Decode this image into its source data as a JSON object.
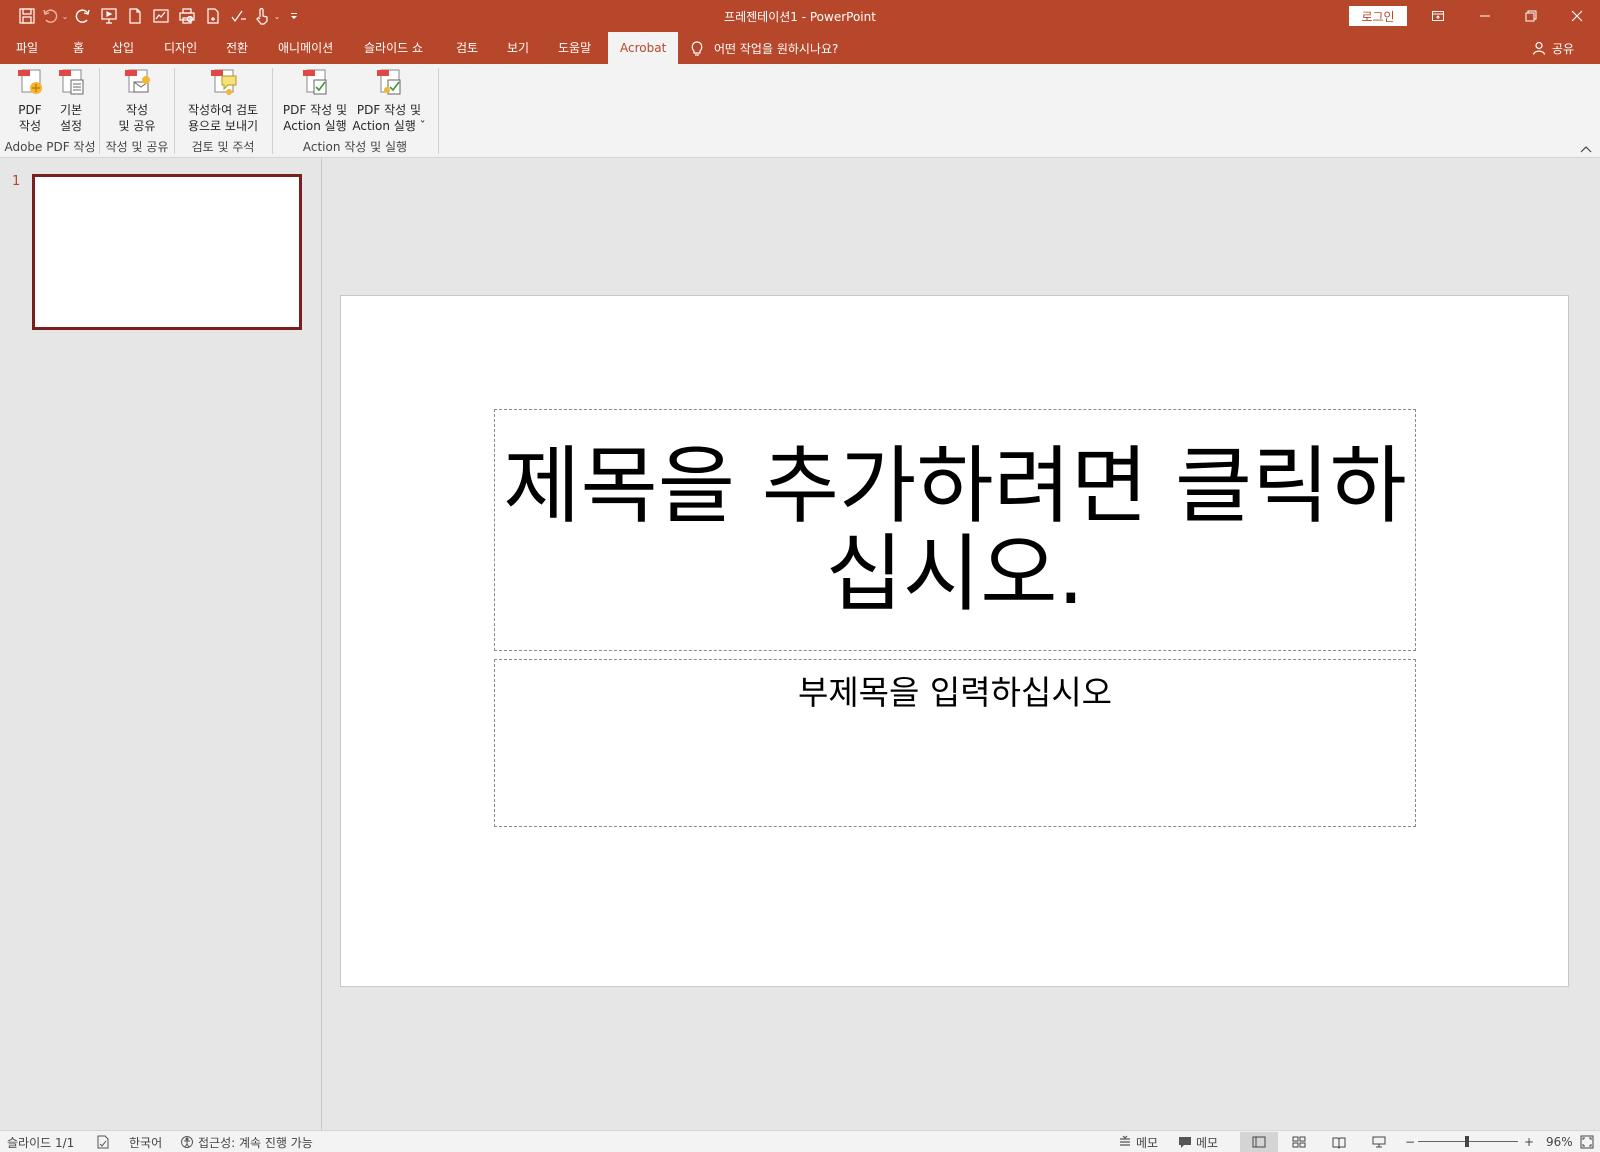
{
  "app": {
    "title": "프레젠테이션1  -  PowerPoint",
    "login_label": "로그인",
    "accent_color": "#b7472a"
  },
  "qat": {
    "icons": [
      "save-icon",
      "undo-icon",
      "redo-icon",
      "start-presentation-icon",
      "new-icon",
      "sign-icon",
      "print-preview-icon",
      "document-icon",
      "spelling-icon",
      "touch-mode-icon",
      "customize-icon"
    ]
  },
  "tabs": [
    {
      "label": "파일"
    },
    {
      "label": "홈"
    },
    {
      "label": "삽입"
    },
    {
      "label": "디자인"
    },
    {
      "label": "전환"
    },
    {
      "label": "애니메이션"
    },
    {
      "label": "슬라이드 쇼"
    },
    {
      "label": "검토"
    },
    {
      "label": "보기"
    },
    {
      "label": "도움말"
    },
    {
      "label": "Acrobat"
    }
  ],
  "tellme": {
    "placeholder": "어떤 작업을 원하시나요?"
  },
  "share_label": "공유",
  "ribbon": {
    "groups": [
      {
        "label": "Adobe PDF 작성",
        "buttons": [
          {
            "label": "PDF\n작성"
          },
          {
            "label": "기본\n설정"
          }
        ]
      },
      {
        "label": "작성 및 공유",
        "buttons": [
          {
            "label": "작성\n및 공유"
          }
        ]
      },
      {
        "label": "검토 및 주석",
        "buttons": [
          {
            "label": "작성하여 검토\n용으로 보내기"
          }
        ]
      },
      {
        "label": "Action 작성 및 실행",
        "buttons": [
          {
            "label": "PDF 작성 및\nAction 실행"
          },
          {
            "label": "PDF 작성 및\nAction 실행 ˇ"
          }
        ]
      }
    ]
  },
  "thumbnails": [
    {
      "number": "1"
    }
  ],
  "slide": {
    "title_placeholder": "제목을 추가하려면 클릭하십시오.",
    "subtitle_placeholder": "부제목을 입력하십시오"
  },
  "status": {
    "slide_count": "슬라이드 1/1",
    "language": "한국어",
    "accessibility": "접근성: 계속 진행 가능",
    "notes_label": "메모",
    "comments_label": "메모",
    "zoom_percent": "96%",
    "zoom_minus": "−",
    "zoom_plus": "+",
    "zoom_level": 0.96
  }
}
